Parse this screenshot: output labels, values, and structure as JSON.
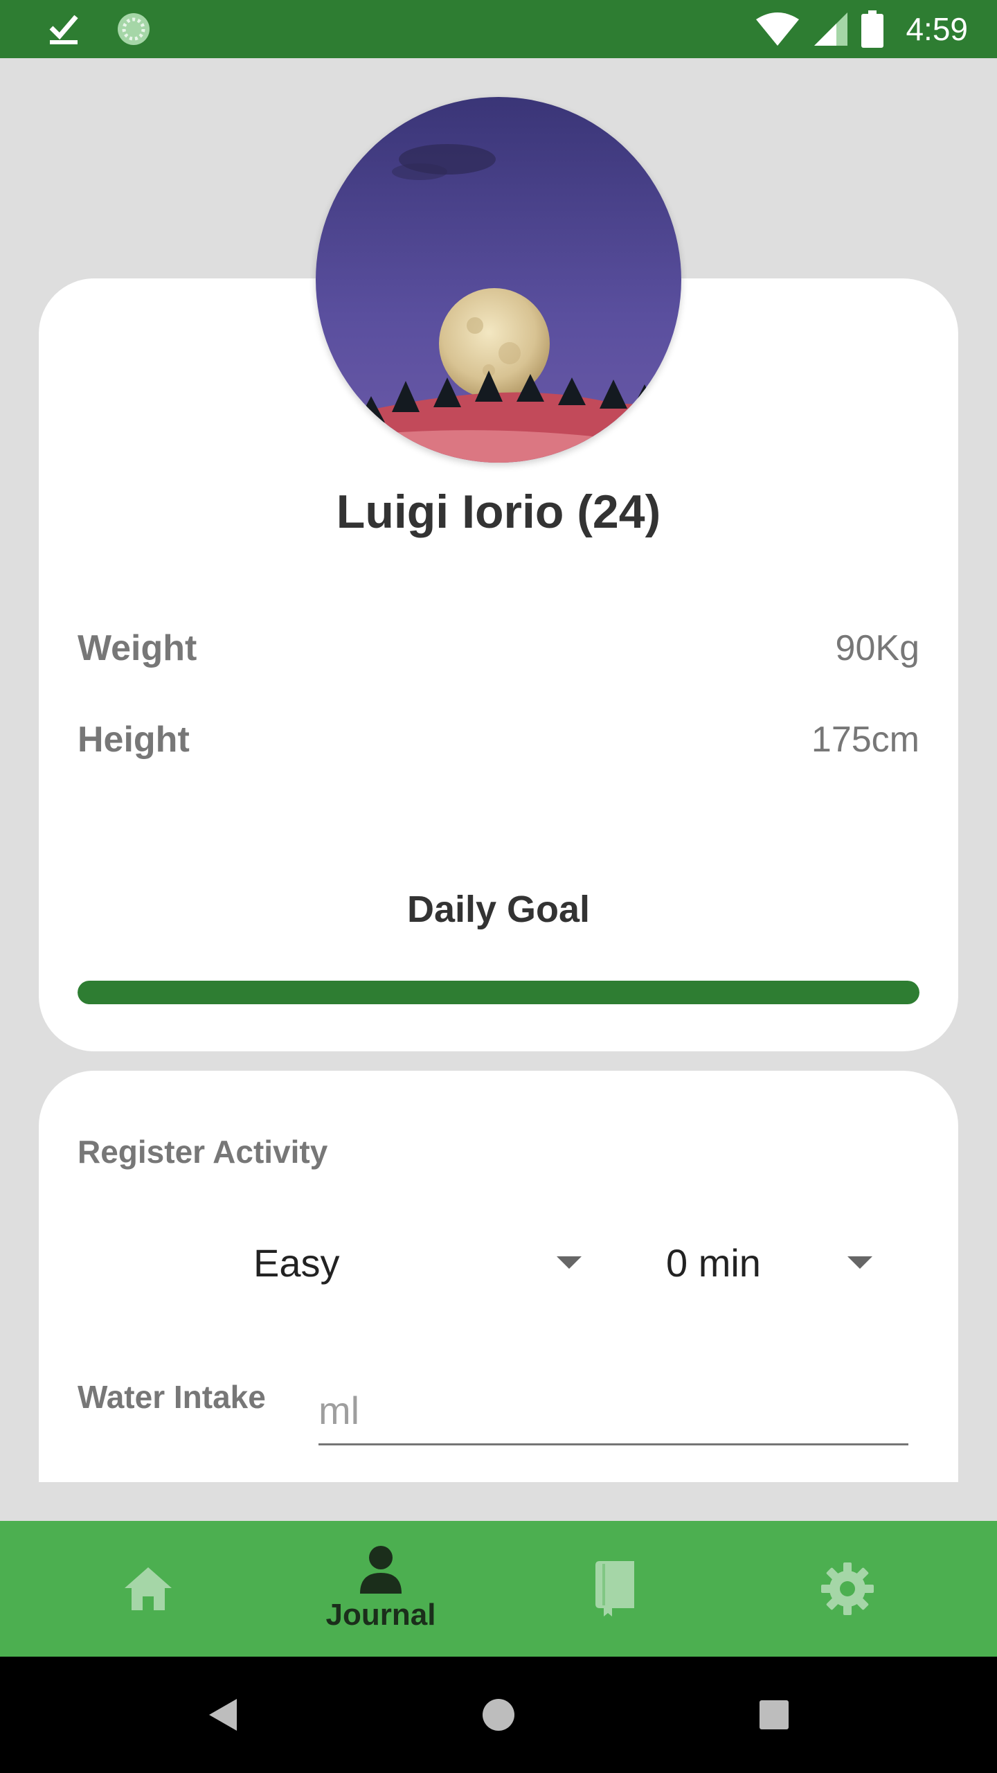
{
  "status_bar": {
    "time": "4:59",
    "left_icons": [
      "check-notification-icon",
      "sync-notification-icon"
    ],
    "right_icons": [
      "wifi-icon",
      "signal-icon",
      "battery-icon"
    ]
  },
  "profile": {
    "name": "Luigi Iorio (24)",
    "avatar": "avatar-moon-photo",
    "stats": [
      {
        "label": "Weight",
        "value": "90Kg"
      },
      {
        "label": "Height",
        "value": "175cm"
      }
    ],
    "daily_goal": {
      "title": "Daily Goal",
      "progress": 1.0
    }
  },
  "activity": {
    "title": "Register Activity",
    "intensity": {
      "selected": "Easy"
    },
    "duration": {
      "selected": "0 min"
    },
    "water": {
      "label": "Water Intake",
      "value": "",
      "placeholder": "ml"
    }
  },
  "bottom_nav": {
    "items": [
      {
        "icon": "home-icon",
        "label": ""
      },
      {
        "icon": "person-icon",
        "label": "Journal",
        "active": true
      },
      {
        "icon": "book-icon",
        "label": ""
      },
      {
        "icon": "gear-icon",
        "label": ""
      }
    ]
  },
  "colors": {
    "status_bar": "#2e7d32",
    "accent": "#2e7d32",
    "nav_bar": "#4caf50",
    "nav_icon_inactive": "#a5d6a7",
    "background": "#dedede"
  }
}
